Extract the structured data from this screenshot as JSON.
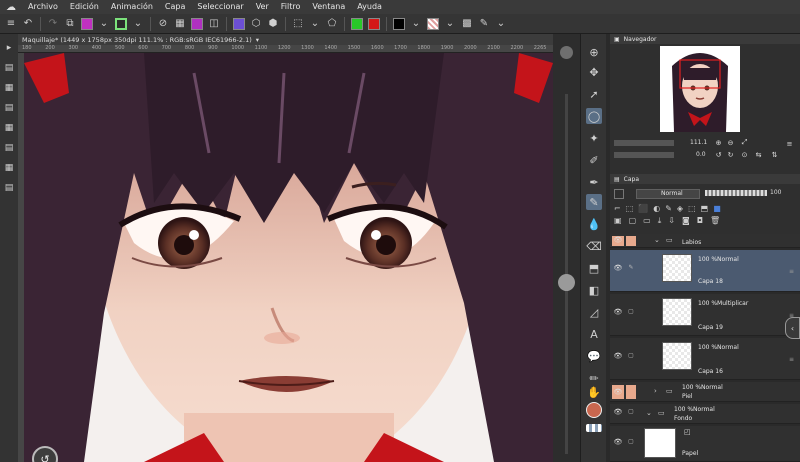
{
  "menu": {
    "items": [
      "Archivo",
      "Edición",
      "Animación",
      "Capa",
      "Seleccionar",
      "Ver",
      "Filtro",
      "Ventana",
      "Ayuda"
    ]
  },
  "document": {
    "tab_title": "Maquillaje* (1449 x 1758px 350dpi 111.1% : RGB:sRGB IEC61966-2.1)",
    "ruler_ticks": [
      "180",
      "200",
      "300",
      "400",
      "500",
      "600",
      "700",
      "800",
      "900",
      "1000",
      "1100",
      "1200",
      "1300",
      "1400",
      "1500",
      "1600",
      "1700",
      "1800",
      "1900",
      "2000",
      "2100",
      "2200",
      "2265"
    ]
  },
  "colors": {
    "accent_selected": "#4b5a70",
    "skin": "#e9c7b6",
    "main_color": "#c8674f",
    "hair": "#3a2434",
    "ribbon": "#c4141a"
  },
  "navigator": {
    "title": "Navegador",
    "zoom": "111.1",
    "rotation": "0.0"
  },
  "layer_panel": {
    "tab": "Capa",
    "blend_mode": "Normal",
    "opacity": "100",
    "layers": [
      {
        "kind": "folder",
        "mode": "",
        "name": "Labios",
        "highlight": true
      },
      {
        "kind": "raster",
        "mode": "100 %Normal",
        "name": "Capa 18",
        "selected": true
      },
      {
        "kind": "raster",
        "mode": "100 %Multiplicar",
        "name": "Capa 19"
      },
      {
        "kind": "raster",
        "mode": "100 %Normal",
        "name": "Capa 16"
      },
      {
        "kind": "folder",
        "mode": "100 %Normal",
        "name": "Piel",
        "highlight": true
      },
      {
        "kind": "folder",
        "mode": "100 %Normal",
        "name": "Fondo"
      },
      {
        "kind": "paper",
        "mode": "",
        "name": "Papel"
      }
    ]
  }
}
